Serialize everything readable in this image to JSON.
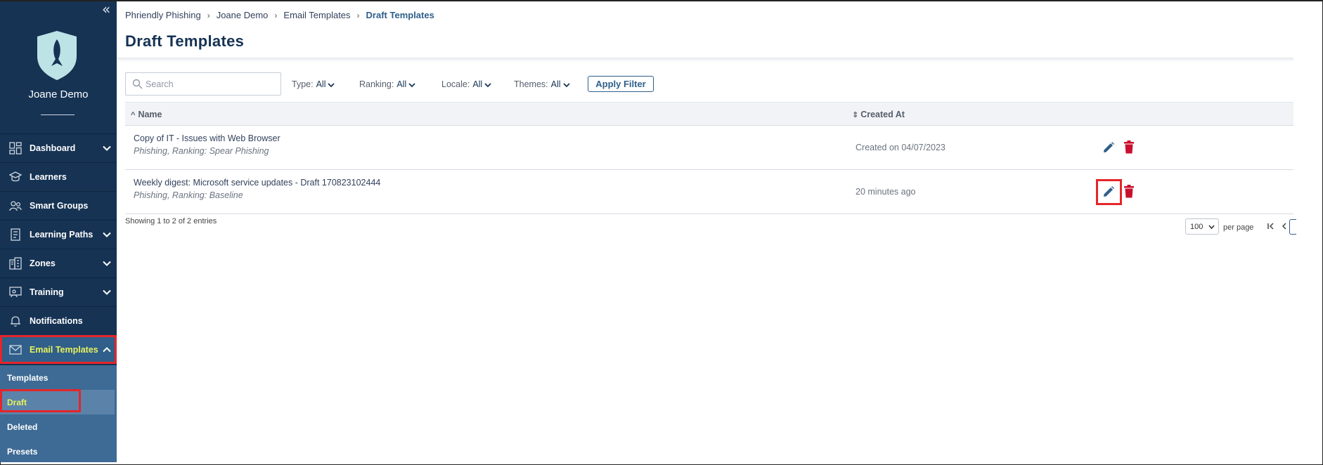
{
  "sidebar": {
    "collapse_glyph": "«",
    "logo_icon": "shield-fish-icon",
    "user_name": "Joane Demo",
    "items": [
      {
        "label": "Dashboard",
        "icon": "dashboard-icon",
        "expandable": true
      },
      {
        "label": "Learners",
        "icon": "learners-icon",
        "expandable": false
      },
      {
        "label": "Smart Groups",
        "icon": "smart-groups-icon",
        "expandable": false
      },
      {
        "label": "Learning Paths",
        "icon": "learning-paths-icon",
        "expandable": true
      },
      {
        "label": "Zones",
        "icon": "zones-icon",
        "expandable": true
      },
      {
        "label": "Training",
        "icon": "training-icon",
        "expandable": true
      },
      {
        "label": "Notifications",
        "icon": "bell-icon",
        "expandable": false
      },
      {
        "label": "Email Templates",
        "icon": "envelope-icon",
        "expandable": true,
        "active": true
      }
    ],
    "subitems": [
      {
        "label": "Templates"
      },
      {
        "label": "Draft",
        "active": true
      },
      {
        "label": "Deleted"
      },
      {
        "label": "Presets"
      }
    ]
  },
  "breadcrumb": [
    "Phriendly Phishing",
    "Joane Demo",
    "Email Templates",
    "Draft Templates"
  ],
  "page_title": "Draft Templates",
  "search": {
    "placeholder": "Search",
    "value": ""
  },
  "filters": [
    {
      "label": "Type:",
      "value": "All"
    },
    {
      "label": "Ranking:",
      "value": "All"
    },
    {
      "label": "Locale:",
      "value": "All"
    },
    {
      "label": "Themes:",
      "value": "All"
    }
  ],
  "apply_filter_label": "Apply Filter",
  "table": {
    "columns": [
      "Name",
      "Created At"
    ],
    "sort_name_glyph": "^",
    "sort_created_glyph": "⇕",
    "rows": [
      {
        "name": "Copy of IT - Issues with Web Browser",
        "meta": "Phishing, Ranking: Spear Phishing",
        "created": "Created on 04/07/2023"
      },
      {
        "name": "Weekly digest: Microsoft service updates - Draft 170823102444",
        "meta": "Phishing, Ranking: Baseline",
        "created": "20 minutes ago"
      }
    ]
  },
  "pagination": {
    "showing": "Showing 1 to 2 of 2 entries",
    "per_page_value": "100",
    "per_page_label": "per page"
  },
  "colors": {
    "sidebar_bg": "#163354",
    "active_item_bg": "#2f5f8a",
    "active_text": "#e9f05c",
    "subnav_bg": "#3e6b95",
    "highlight_red": "#e5252a",
    "delete_red": "#c8102e",
    "edit_blue": "#2f5f8a"
  }
}
